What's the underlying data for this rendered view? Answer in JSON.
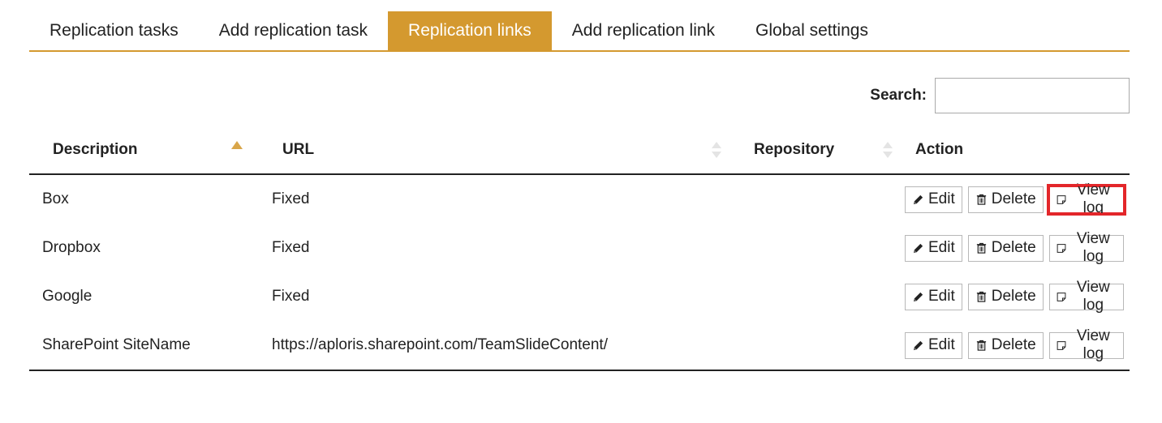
{
  "tabs": [
    {
      "label": "Replication tasks",
      "active": false
    },
    {
      "label": "Add replication task",
      "active": false
    },
    {
      "label": "Replication links",
      "active": true
    },
    {
      "label": "Add replication link",
      "active": false
    },
    {
      "label": "Global settings",
      "active": false
    }
  ],
  "search": {
    "label": "Search:",
    "value": "",
    "placeholder": ""
  },
  "table": {
    "columns": [
      "Description",
      "URL",
      "Repository",
      "Action"
    ],
    "rows": [
      {
        "description": "Box",
        "url": "Fixed",
        "repository": ""
      },
      {
        "description": "Dropbox",
        "url": "Fixed",
        "repository": ""
      },
      {
        "description": "Google",
        "url": "Fixed",
        "repository": ""
      },
      {
        "description": "SharePoint SiteName",
        "url": "https://aploris.sharepoint.com/TeamSlideContent/",
        "repository": ""
      }
    ],
    "action_labels": {
      "edit": "Edit",
      "delete": "Delete",
      "view_log": "View log"
    }
  },
  "colors": {
    "accent": "#d4992f",
    "highlight": "#e3262a"
  },
  "icons": {
    "edit": "pencil-icon",
    "delete": "trash-icon",
    "view_log": "note-icon"
  }
}
